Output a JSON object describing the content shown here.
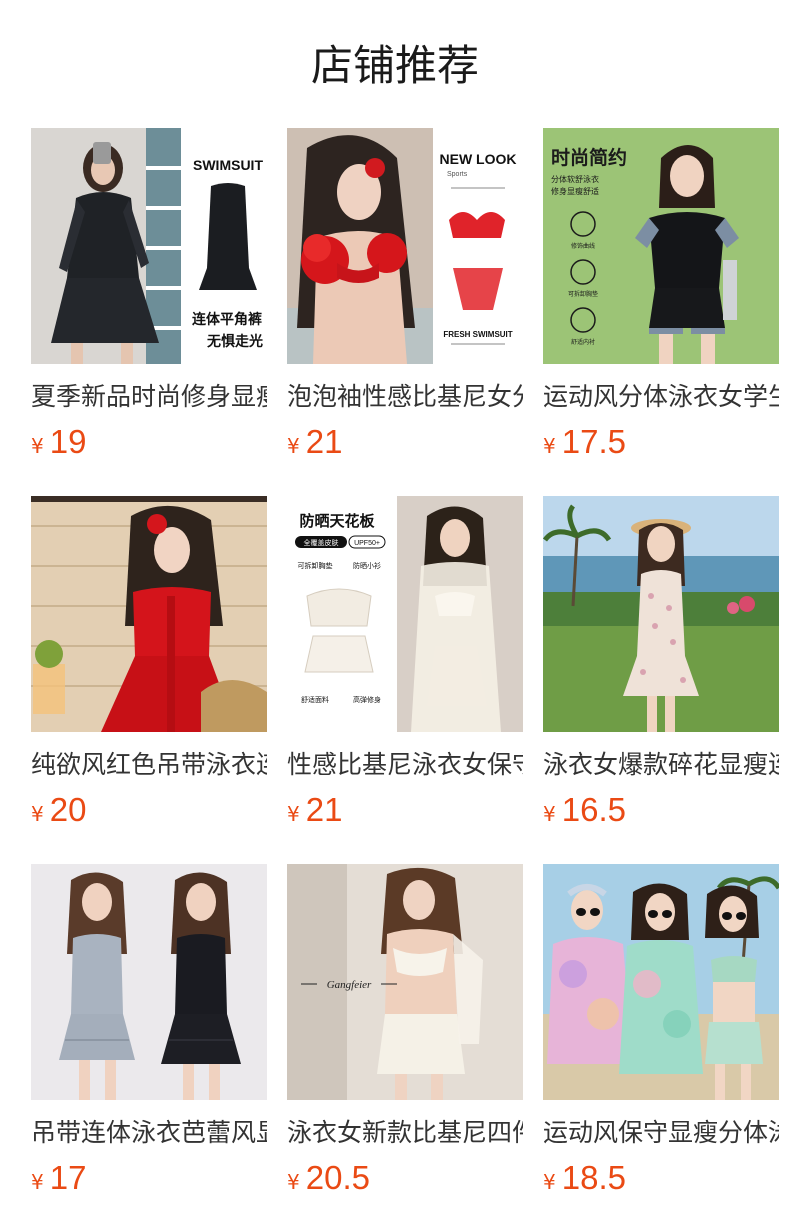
{
  "section": {
    "title": "店铺推荐"
  },
  "colors": {
    "price": "#ea4a14",
    "title_text": "#333333"
  },
  "products": [
    {
      "title": "夏季新品时尚修身显瘦长袖连体泳衣",
      "currency": "¥",
      "price": "19",
      "image_icon": "product-photo-black-swim-dress",
      "overlay": {
        "top": "SWIMSUIT",
        "line1": "连体平角裤",
        "line2": "无惧走光"
      }
    },
    {
      "title": "泡泡袖性感比基尼女分体泳衣",
      "currency": "¥",
      "price": "21",
      "image_icon": "product-photo-red-bikini",
      "overlay": {
        "top": "NEW LOOK",
        "sub": "Sports",
        "bottom": "FRESH SWIMSUIT"
      }
    },
    {
      "title": "运动风分体泳衣女学生保守",
      "currency": "¥",
      "price": "17.5",
      "image_icon": "product-photo-sport-swimsuit",
      "overlay": {
        "top": "时尚简约",
        "sub": "分体软舒泳衣",
        "sub2": "修身显瘦舒适",
        "f1": "修饰曲线",
        "f2": "可拆卸胸垫",
        "f3": "舒适内衬"
      }
    },
    {
      "title": "纯欲风红色吊带泳衣连体",
      "currency": "¥",
      "price": "20",
      "image_icon": "product-photo-red-dress",
      "overlay": {}
    },
    {
      "title": "性感比基尼泳衣女保守三件套",
      "currency": "¥",
      "price": "21",
      "image_icon": "product-photo-white-bikini-set",
      "overlay": {
        "top": "防晒天花板",
        "badge1": "全覆盖皮肤",
        "badge2": "UPF50+",
        "f1": "可拆卸胸垫",
        "f2": "防晒小衫",
        "f3": "舒适面料",
        "f4": "高弹修身"
      }
    },
    {
      "title": "泳衣女爆款碎花显瘦连体",
      "currency": "¥",
      "price": "16.5",
      "image_icon": "product-photo-floral-swimsuit",
      "overlay": {}
    },
    {
      "title": "吊带连体泳衣芭蕾风显瘦",
      "currency": "¥",
      "price": "17",
      "image_icon": "product-photo-ruffle-swim-dresses",
      "overlay": {}
    },
    {
      "title": "泳衣女新款比基尼四件套",
      "currency": "¥",
      "price": "20.5",
      "image_icon": "product-photo-white-wrap-bikini",
      "overlay": {
        "watermark": "Gangfeier"
      }
    },
    {
      "title": "运动风保守显瘦分体泳衣",
      "currency": "¥",
      "price": "18.5",
      "image_icon": "product-photo-tie-dye-set",
      "overlay": {}
    }
  ]
}
